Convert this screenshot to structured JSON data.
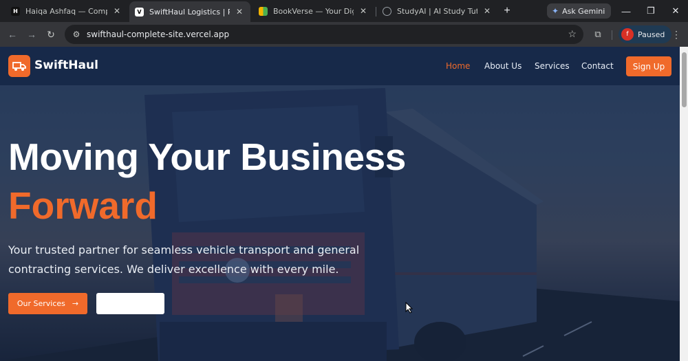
{
  "browser": {
    "tabs": [
      {
        "title": "Haiqa Ashfaq — Computer Sc",
        "favicon": "H"
      },
      {
        "title": "SwiftHaul Logistics | Professio",
        "favicon": "V"
      },
      {
        "title": "BookVerse — Your Digital Libr",
        "favicon": ""
      },
      {
        "title": "StudyAI | AI Study Tutor by Ha",
        "favicon": ""
      }
    ],
    "active_tab": 1,
    "ask_gemini": "Ask Gemini",
    "url": "swifthaul-complete-site.vercel.app",
    "profile_initial": "f",
    "profile_status": "Paused"
  },
  "site": {
    "brand": "SwiftHaul",
    "nav": {
      "home": "Home",
      "about": "About Us",
      "services": "Services",
      "contact": "Contact"
    },
    "signup": "Sign Up",
    "hero": {
      "headline_line1": "Moving Your Business",
      "headline_line2": "Forward",
      "lead": "Your trusted partner for seamless vehicle transport and general contracting services. We deliver excellence with every mile.",
      "primary_cta": "Our Services",
      "secondary_cta": ""
    }
  },
  "colors": {
    "accent": "#f06a2b",
    "navbar": "#162848",
    "browser_bg": "#202124",
    "toolbar_bg": "#35363a"
  }
}
